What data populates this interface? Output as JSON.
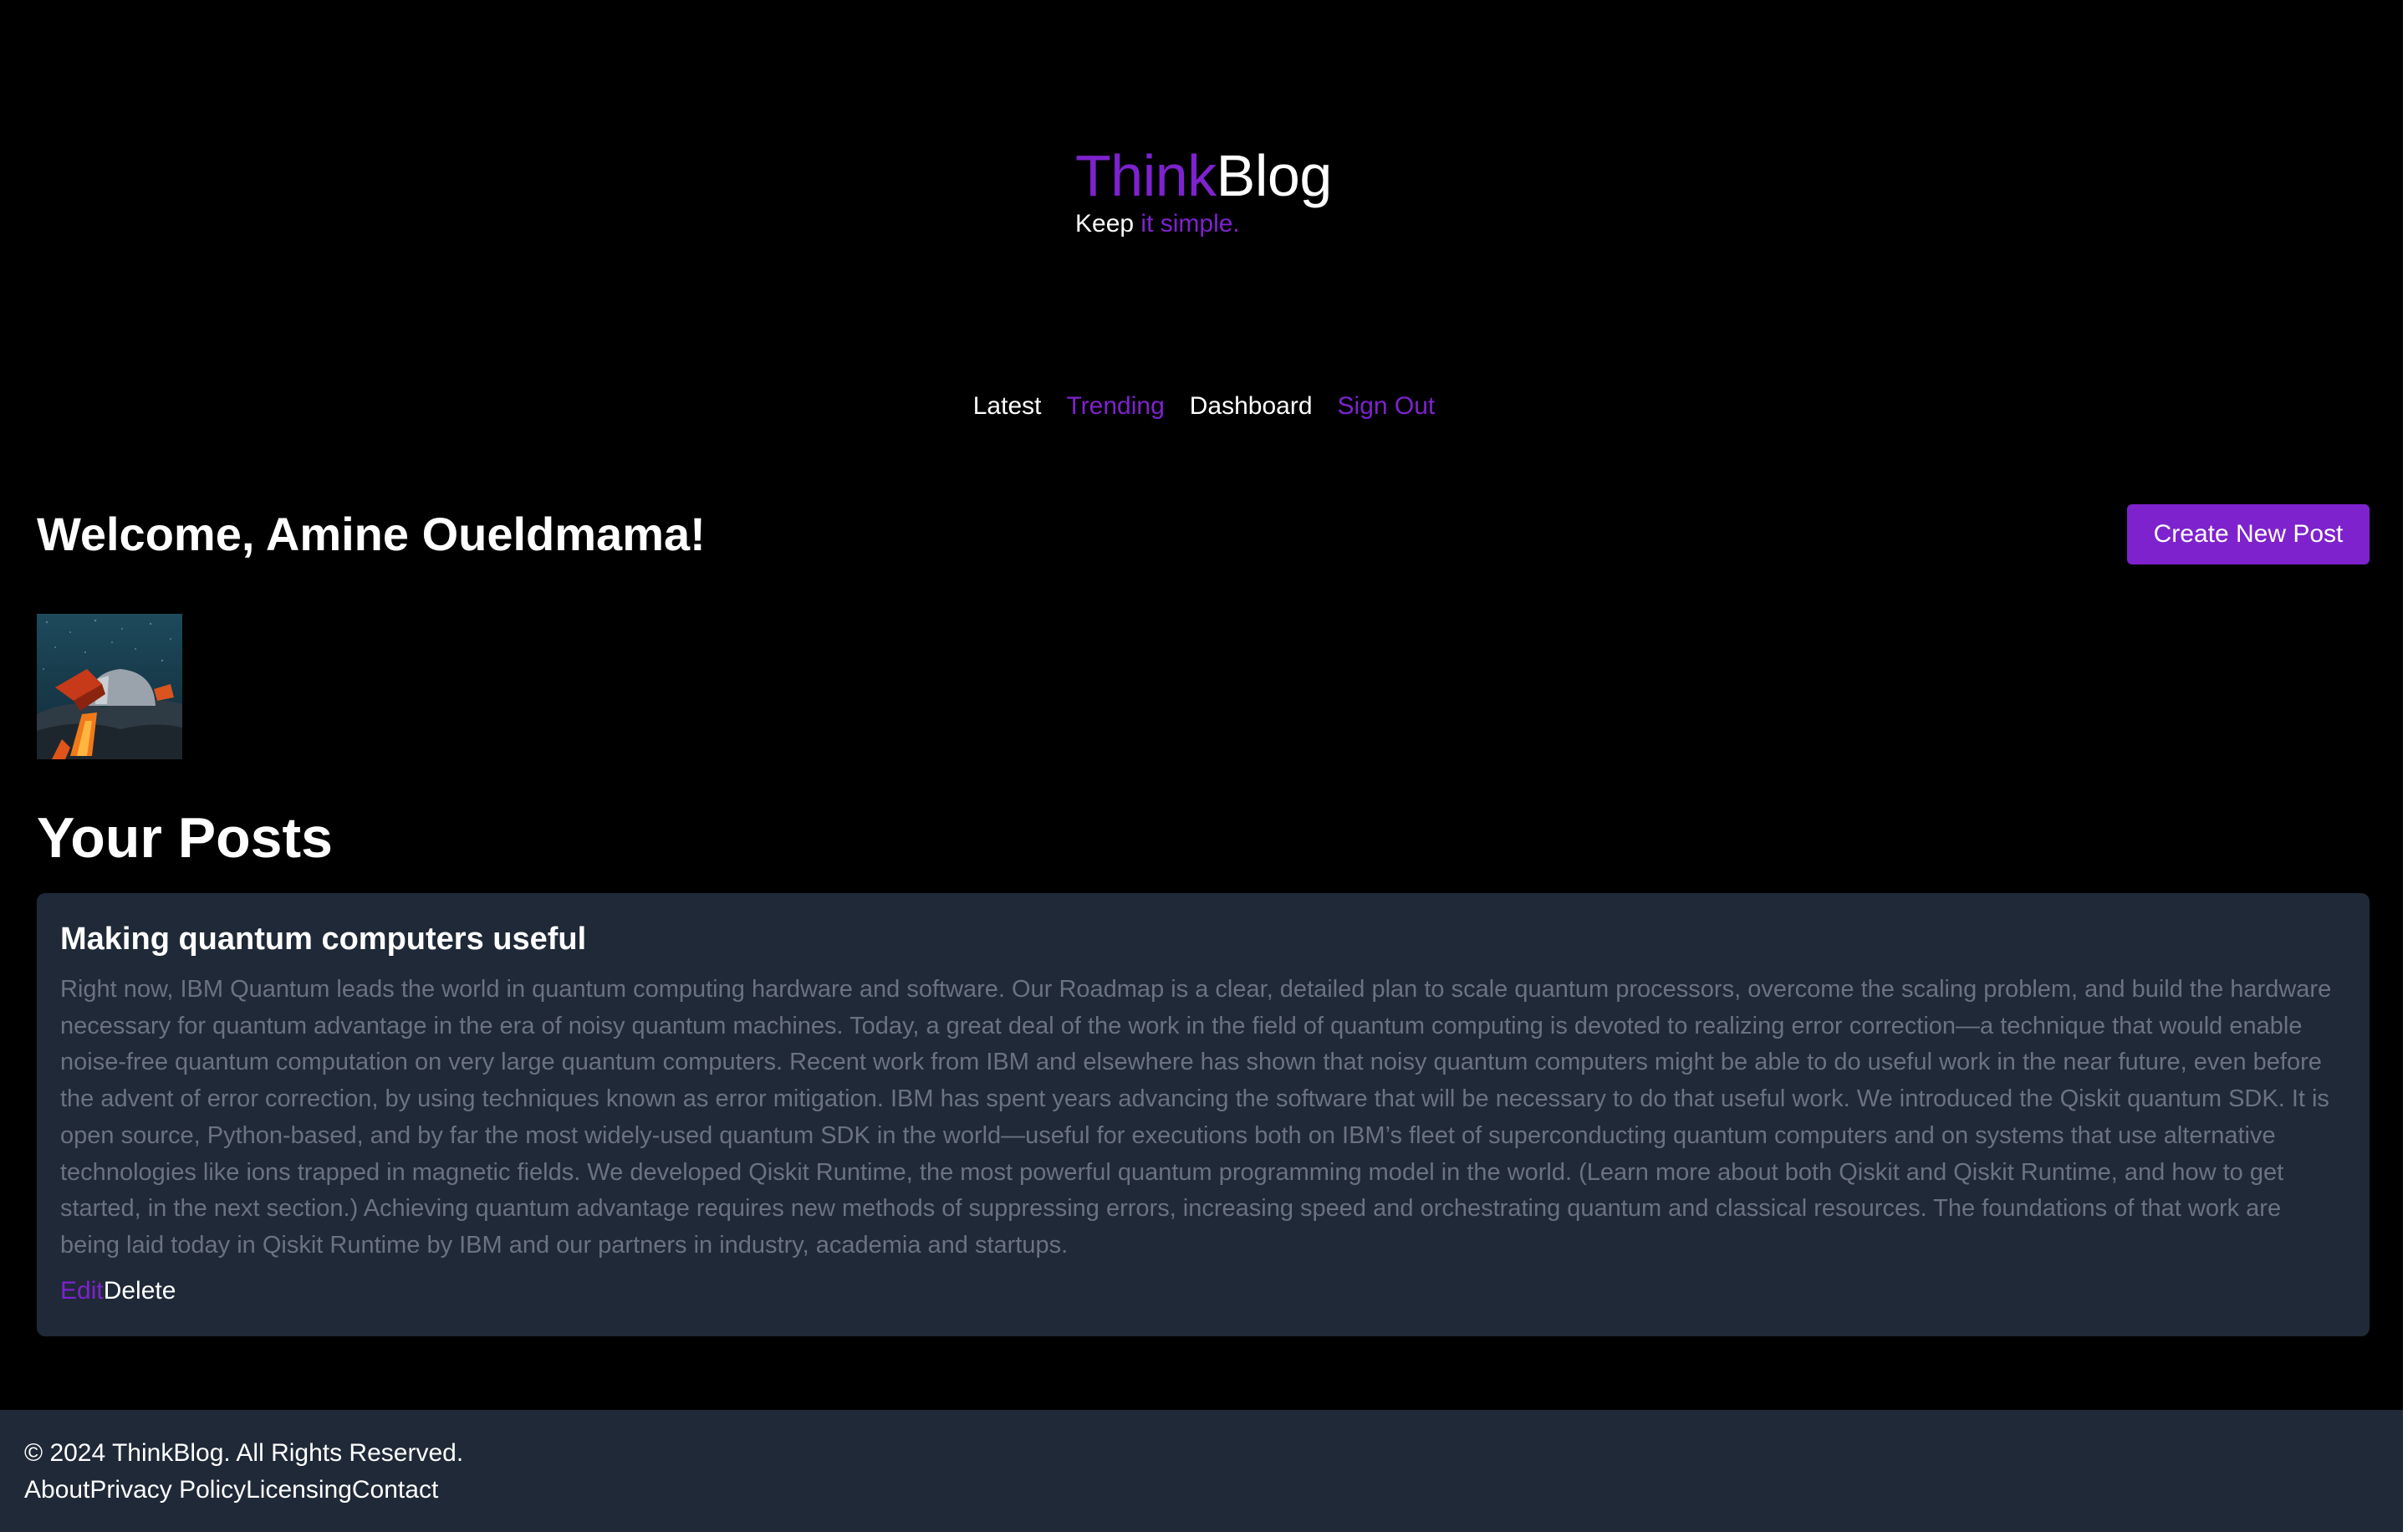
{
  "colors": {
    "background": "#000000",
    "accent": "#7e22ce",
    "card": "#1f2937",
    "muted_text": "#6b7280"
  },
  "header": {
    "logo_part1": "Think",
    "logo_part2": "Blog",
    "tagline_part1": "Keep ",
    "tagline_part2": "it simple."
  },
  "nav": {
    "items": [
      {
        "label": "Latest",
        "color": "white"
      },
      {
        "label": "Trending",
        "color": "purple"
      },
      {
        "label": "Dashboard",
        "color": "white"
      },
      {
        "label": "Sign Out",
        "color": "purple"
      }
    ]
  },
  "dashboard": {
    "welcome": "Welcome, Amine Oueldmama!",
    "create_button": "Create New Post",
    "avatar_icon": "user-avatar-image",
    "section_title": "Your Posts"
  },
  "posts": [
    {
      "title": "Making quantum computers useful",
      "body": "Right now, IBM Quantum leads the world in quantum computing hardware and software. Our Roadmap is a clear, detailed plan to scale quantum processors, overcome the scaling problem, and build the hardware necessary for quantum advantage in the era of noisy quantum machines. Today, a great deal of the work in the field of quantum computing is devoted to realizing error correction—a technique that would enable noise-free quantum computation on very large quantum computers. Recent work from IBM and elsewhere has shown that noisy quantum computers might be able to do useful work in the near future, even before the advent of error correction, by using techniques known as error mitigation. IBM has spent years advancing the software that will be necessary to do that useful work. We introduced the Qiskit quantum SDK. It is open source, Python-based, and by far the most widely-used quantum SDK in the world—useful for executions both on IBM’s fleet of superconducting quantum computers and on systems that use alternative technologies like ions trapped in magnetic fields. We developed Qiskit Runtime, the most powerful quantum programming model in the world. (Learn more about both Qiskit and Qiskit Runtime, and how to get started, in the next section.) Achieving quantum advantage requires new methods of suppressing errors, increasing speed and orchestrating quantum and classical resources. The foundations of that work are being laid today in Qiskit Runtime by IBM and our partners in industry, academia and startups.",
      "edit_label": "Edit",
      "delete_label": "Delete"
    }
  ],
  "footer": {
    "copyright": "© 2024 ThinkBlog. All Rights Reserved.",
    "links": [
      "About",
      "Privacy Policy",
      "Licensing",
      "Contact"
    ]
  }
}
